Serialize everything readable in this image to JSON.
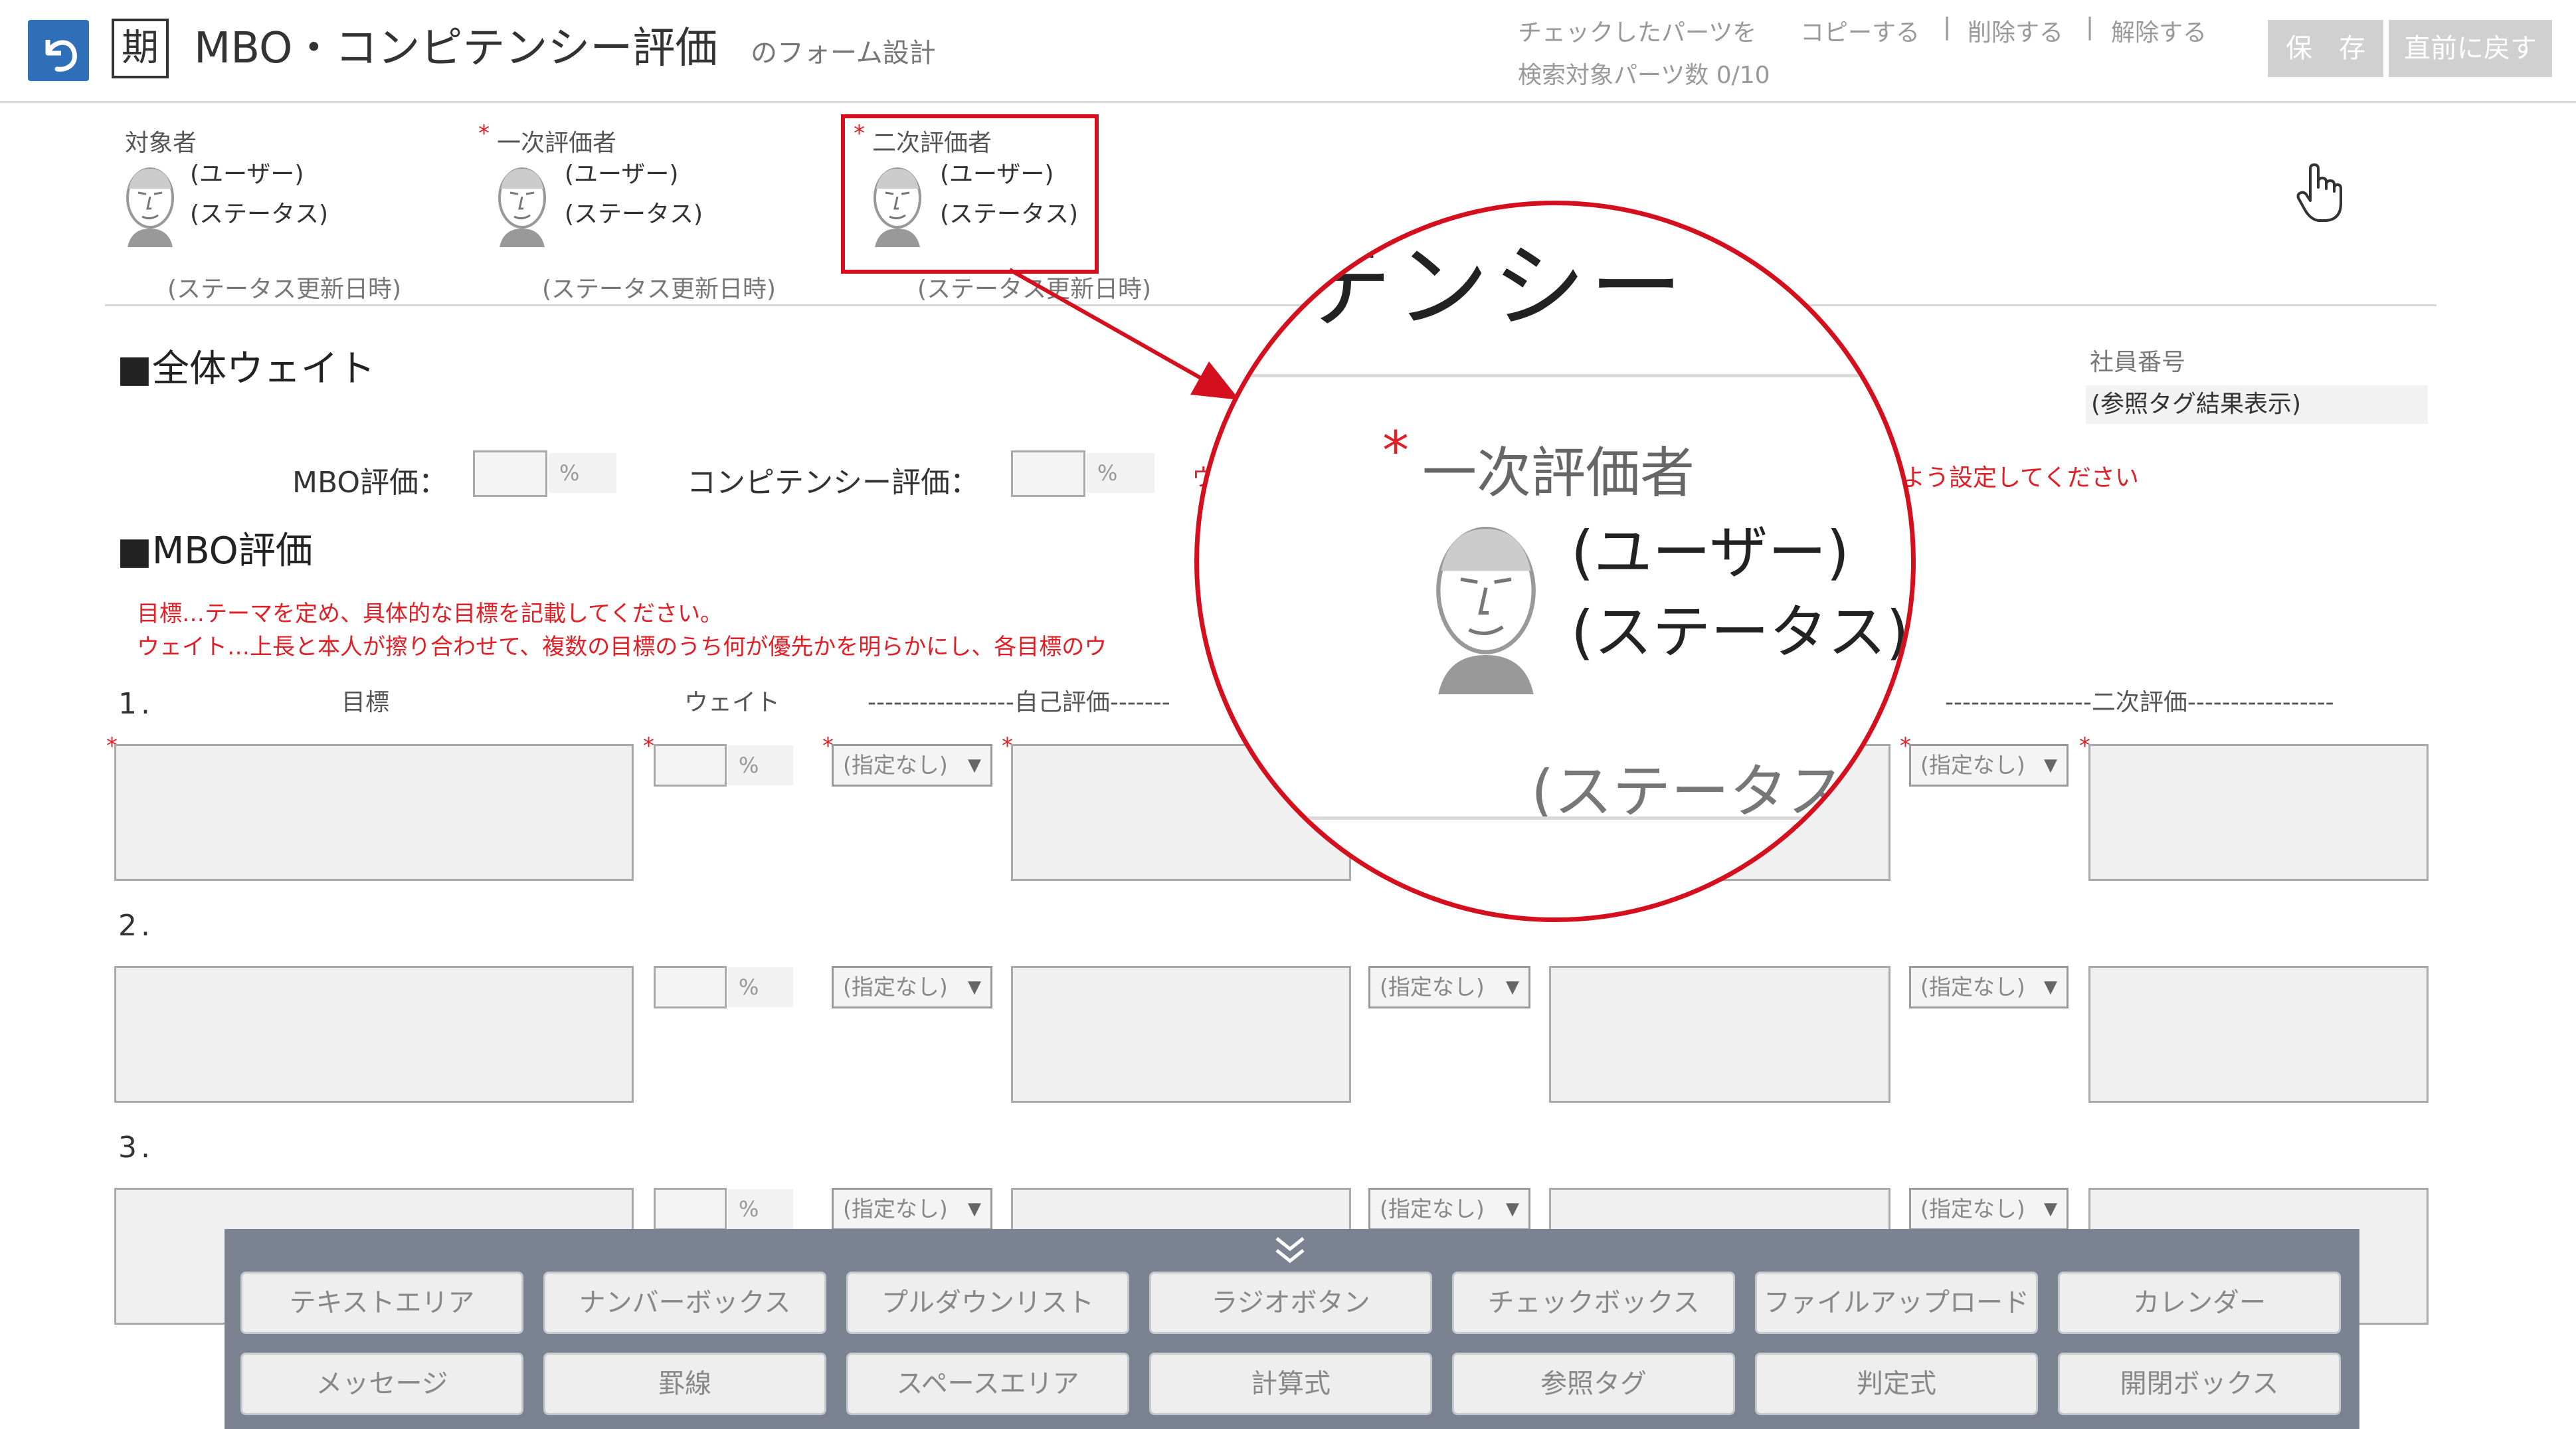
{
  "header": {
    "back_icon": "back-arrow-icon",
    "period_badge": "期",
    "title": "MBO・コンピテンシー評価",
    "subtitle": "のフォーム設計",
    "checked_parts_label": "チェックしたパーツを",
    "copy_label": "コピーする",
    "delete_label": "削除する",
    "release_label": "解除する",
    "separator": "|",
    "search_count_label": "検索対象パーツ数 0/10",
    "save_label": "保　存",
    "revert_label": "直前に戻す"
  },
  "evaluators": [
    {
      "role": "対象者",
      "user": "(ユーザー)",
      "status": "(ステータス)",
      "updated": "(ステータス更新日時)",
      "required": false
    },
    {
      "role": "一次評価者",
      "user": "(ユーザー)",
      "status": "(ステータス)",
      "updated": "(ステータス更新日時)",
      "required": true
    },
    {
      "role": "二次評価者",
      "user": "(ユーザー)",
      "status": "(ステータス)",
      "updated": "(ステータス更新日時)",
      "required": true
    }
  ],
  "employee": {
    "label": "社員番号",
    "value": "(参照タグ結果表示)"
  },
  "overall_weight": {
    "heading": "■全体ウェイト",
    "mbo_label": "MBO評価：",
    "competency_label": "コンピテンシー評価：",
    "unit": "%",
    "note_visible": "ウ",
    "note_tail": "よう設定してください"
  },
  "mbo": {
    "heading": "■MBO評価",
    "instruction1": "目標…テーマを定め、具体的な目標を記載してください。",
    "instruction2": "ウェイト…上長と本人が擦り合わせて、複数の目標のうち何が優先かを明らかにし、各目標のウ",
    "col_goal": "目標",
    "col_weight": "ウェイト",
    "col_self": "-----------------自己評価-------",
    "col_second": "-----------------二次評価-----------------",
    "rows": [
      {
        "num": "1.",
        "select_value": "(指定なし)"
      },
      {
        "num": "2.",
        "select_value": "(指定なし)"
      },
      {
        "num": "3.",
        "select_value": "(指定なし)"
      }
    ]
  },
  "zoom": {
    "title_fragment": "テンシー",
    "role": "一次評価者",
    "user": "(ユーザー)",
    "status": "(ステータス)",
    "updated": "(ステータス更"
  },
  "palette": {
    "collapse_icon": "double-chevron-down-icon",
    "row1": [
      "テキストエリア",
      "ナンバーボックス",
      "プルダウンリスト",
      "ラジオボタン",
      "チェックボックス",
      "ファイルアップロード",
      "カレンダー"
    ],
    "row2": [
      "メッセージ",
      "罫線",
      "スペースエリア",
      "計算式",
      "参照タグ",
      "判定式",
      "開閉ボックス"
    ]
  },
  "colors": {
    "accent_blue": "#2f6fb8",
    "required_red": "#e01f26",
    "highlight_red": "#d5101e",
    "palette_bg": "#7b8392"
  }
}
